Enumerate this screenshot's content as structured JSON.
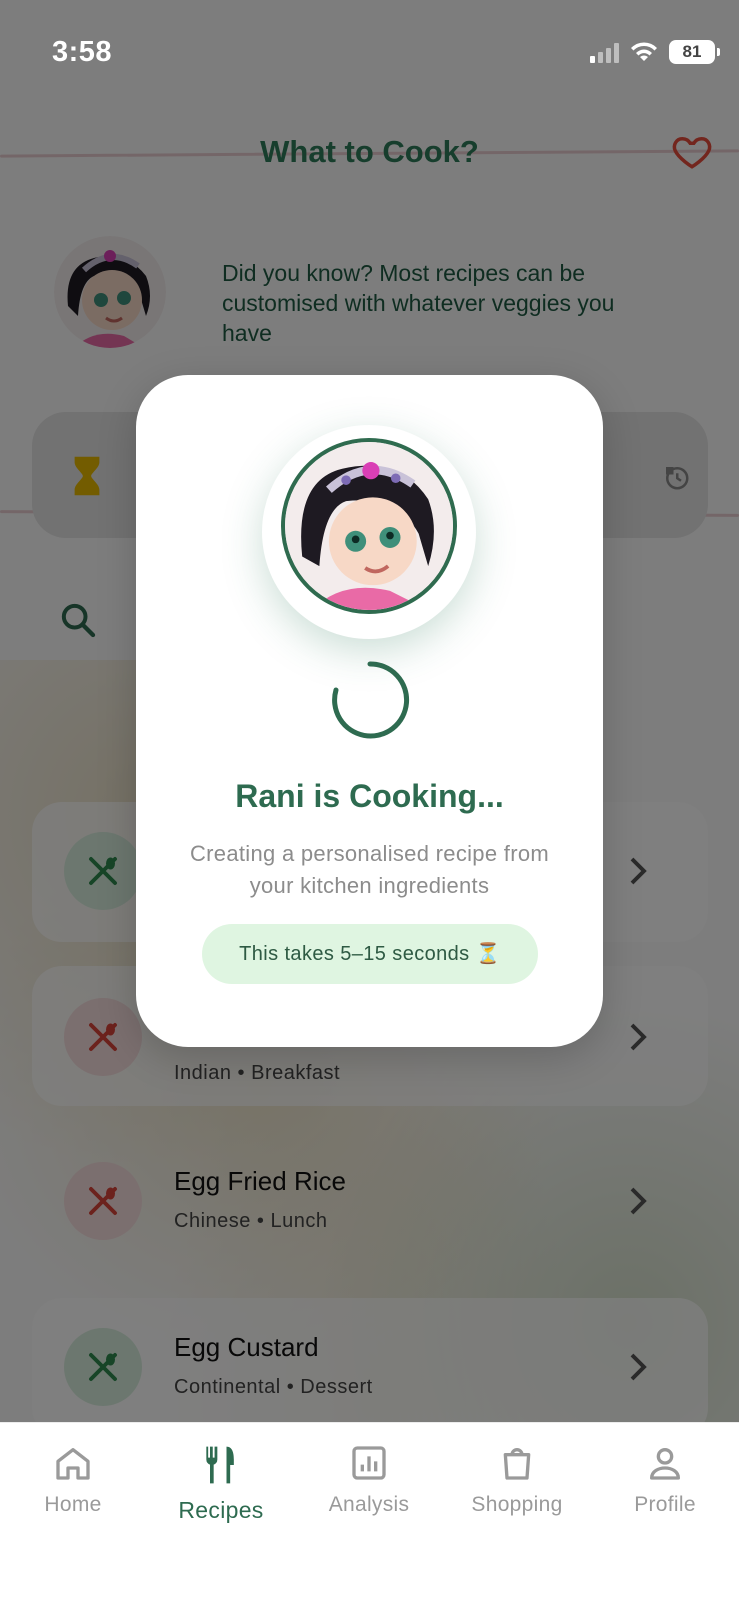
{
  "status_bar": {
    "time": "3:58",
    "battery": "81"
  },
  "header": {
    "title": "What to Cook?"
  },
  "tip": {
    "text": "Did you know? Most recipes can be customised with whatever veggies you have"
  },
  "recipes": [
    {
      "name": "",
      "meta": "",
      "icon_color": "green"
    },
    {
      "name": "",
      "meta": "Indian • Breakfast",
      "icon_color": "red"
    },
    {
      "name": "Egg Fried Rice",
      "meta": "Chinese • Lunch",
      "icon_color": "red"
    },
    {
      "name": "Egg Custard",
      "meta": "Continental • Dessert",
      "icon_color": "green"
    }
  ],
  "modal": {
    "title": "Rani is Cooking...",
    "subtitle": "Creating a personalised recipe from your kitchen ingredients",
    "pill": "This takes 5–15 seconds ⏳"
  },
  "nav": {
    "items": [
      {
        "label": "Home",
        "icon": "home-icon"
      },
      {
        "label": "Recipes",
        "icon": "fork-knife-icon",
        "active": true
      },
      {
        "label": "Analysis",
        "icon": "chart-icon"
      },
      {
        "label": "Shopping",
        "icon": "bag-icon"
      },
      {
        "label": "Profile",
        "icon": "person-icon"
      }
    ]
  },
  "colors": {
    "brand_green": "#2e7d5a",
    "dark_green": "#2e6b50",
    "heart_red": "#e74c3c",
    "pill_bg": "#dff5e1"
  }
}
